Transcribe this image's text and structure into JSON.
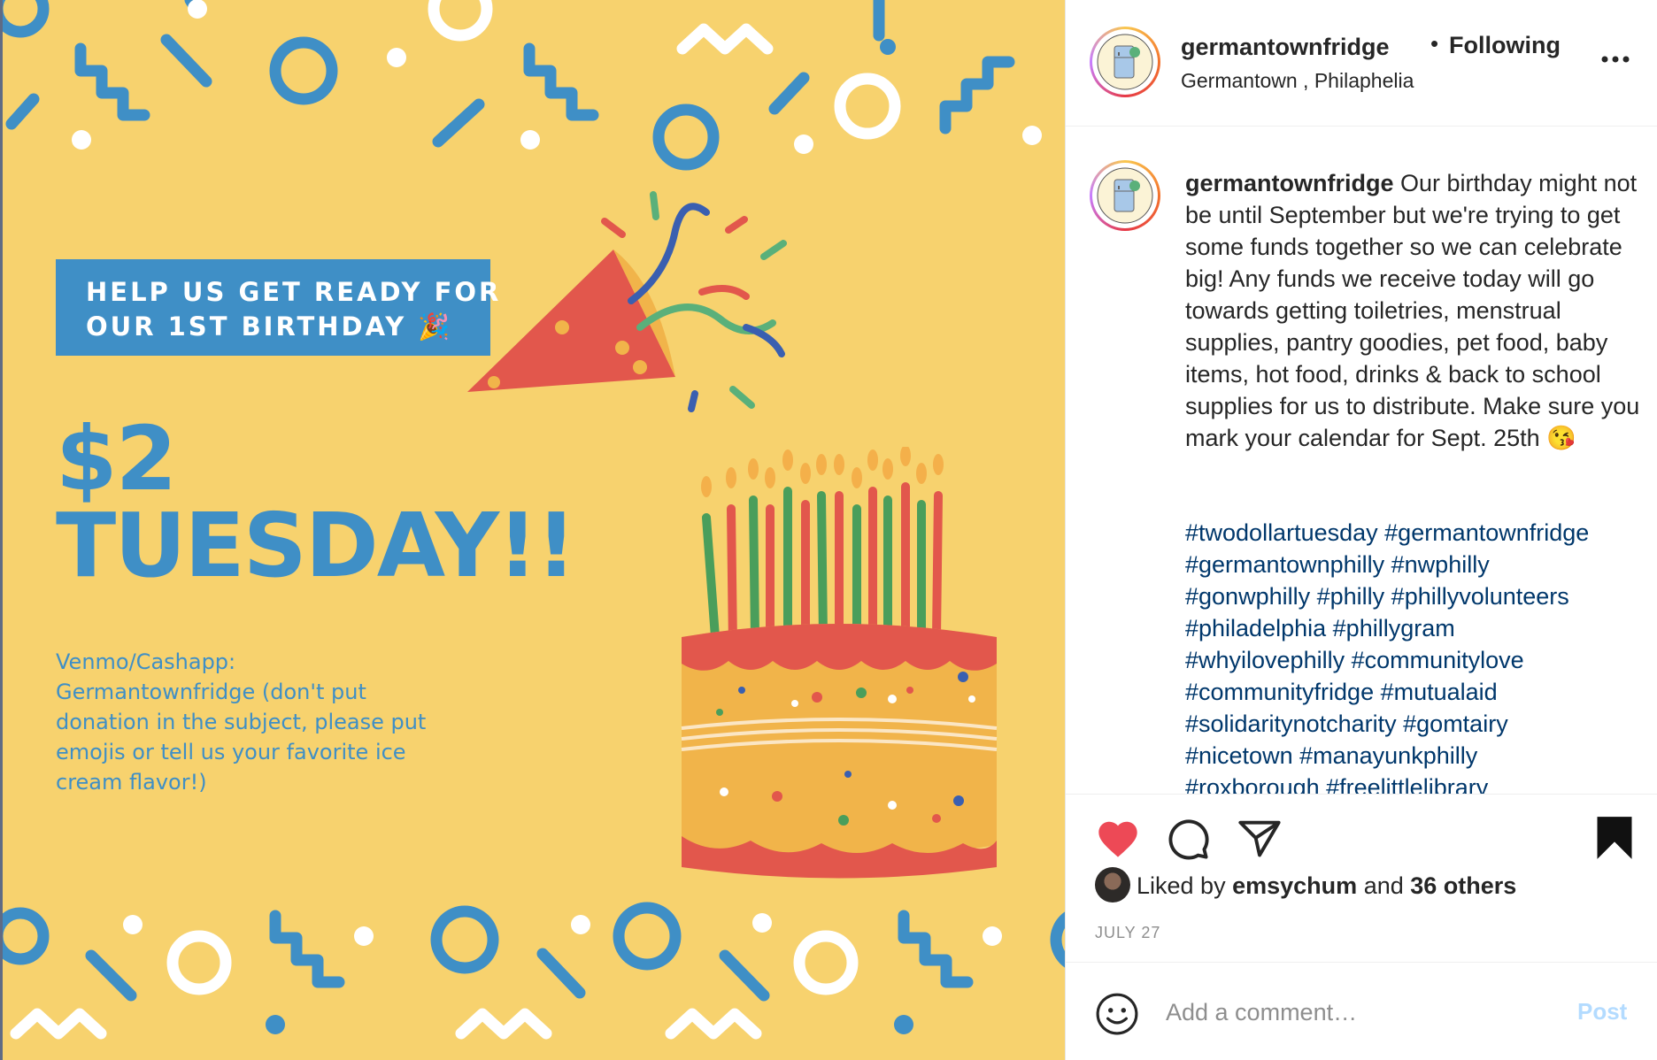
{
  "post_image": {
    "banner_line1": "HELP US GET READY FOR",
    "banner_line2": "OUR 1ST BIRTHDAY 🎉",
    "headline_line1": "$2",
    "headline_line2": "TUESDAY!!",
    "donation_text": "Venmo/Cashapp: Germantownfridge (don't put donation in the subject, please put emojis or tell us your favorite ice cream flavor!)",
    "colors": {
      "background": "#f7d26e",
      "accent_blue": "#3f8fc6",
      "white": "#ffffff"
    }
  },
  "header": {
    "username": "germantownfridge",
    "separator": "•",
    "follow_status": "Following",
    "location": "Germantown , Philaphelia",
    "more_icon": "more-options-icon"
  },
  "caption": {
    "username": "germantownfridge",
    "text": "Our birthday might not be until September but we're trying to get some funds together so we can celebrate big! Any funds we receive today will go towards getting toiletries, menstrual supplies, pantry goodies, pet food, baby items, hot food, drinks & back to school supplies for us to distribute. Make sure you mark your calendar for Sept. 25th 😘",
    "hashtags": [
      "#twodollartuesday",
      "#germantownfridge",
      "#germantownphilly",
      "#nwphilly",
      "#gonwphilly",
      "#philly",
      "#phillyvolunteers",
      "#philadelphia",
      "#phillygram",
      "#whyilovephilly",
      "#communitylove",
      "#communityfridge",
      "#mutualaid",
      "#solidaritynotcharity",
      "#gomtairy",
      "#nicetown",
      "#manayunkphilly",
      "#roxborough",
      "#freelittlelibrary"
    ]
  },
  "actions": {
    "like_icon": "heart-filled-icon",
    "comment_icon": "comment-icon",
    "share_icon": "send-icon",
    "save_icon": "bookmark-filled-icon",
    "likes_prefix": "Liked by",
    "liked_by_user": "emsychum",
    "likes_and": "and",
    "likes_others": "36 others",
    "date": "JULY 27",
    "like_color": "#ed4956"
  },
  "comment": {
    "emoji_icon": "smiley-icon",
    "placeholder": "Add a comment…",
    "post_label": "Post"
  }
}
